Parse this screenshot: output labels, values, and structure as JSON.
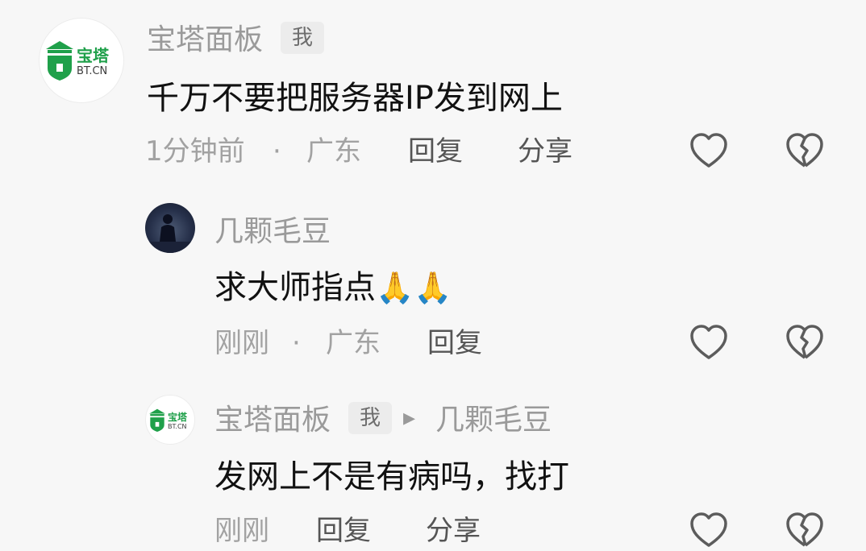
{
  "comments": [
    {
      "avatar": {
        "logo_top": "宝塔",
        "logo_bottom": "BT.CN"
      },
      "author": "宝塔面板",
      "me_tag": "我",
      "text": "千万不要把服务器IP发到网上",
      "time": "1分钟前",
      "sep": "·",
      "location": "广东",
      "reply_label": "回复",
      "share_label": "分享"
    },
    {
      "author": "几颗毛豆",
      "text": "求大师指点",
      "emoji": [
        "🙏",
        "🙏"
      ],
      "time": "刚刚",
      "sep": "·",
      "location": "广东",
      "reply_label": "回复"
    },
    {
      "avatar": {
        "logo_top": "宝塔",
        "logo_bottom": "BT.CN"
      },
      "author": "宝塔面板",
      "me_tag": "我",
      "reply_to_arrow": "▸",
      "reply_to": "几颗毛豆",
      "text": "发网上不是有病吗，找打",
      "time": "刚刚",
      "reply_label": "回复",
      "share_label": "分享"
    }
  ],
  "icons": {
    "like": "heart-outline-icon",
    "dislike": "broken-heart-outline-icon"
  },
  "colors": {
    "brand_green": "#1fa04a",
    "meta_grey": "#a2a2a2",
    "background": "#f7f7f7"
  }
}
